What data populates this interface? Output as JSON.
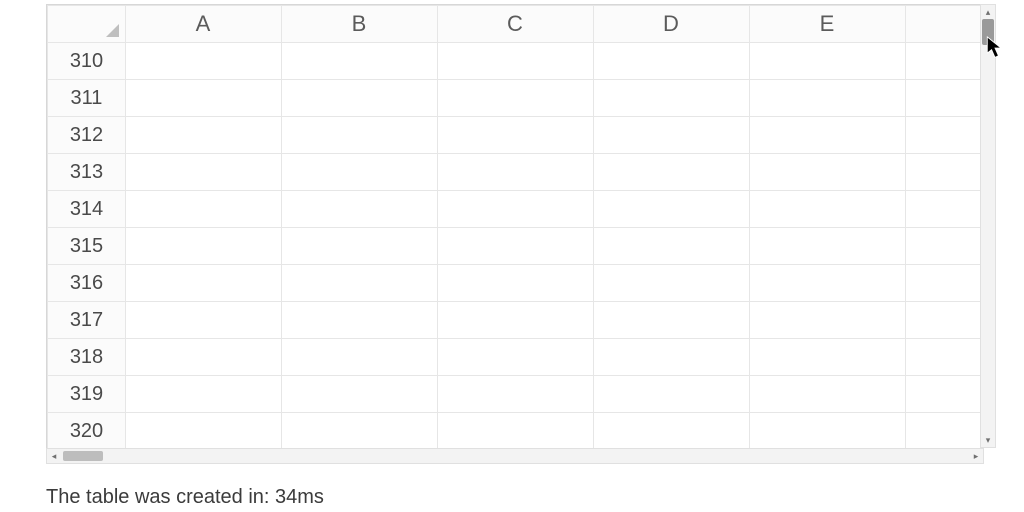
{
  "sheet": {
    "columns": [
      "A",
      "B",
      "C",
      "D",
      "E"
    ],
    "row_numbers": [
      310,
      311,
      312,
      313,
      314,
      315,
      316,
      317,
      318,
      319,
      320
    ]
  },
  "scroll": {
    "up_glyph": "▴",
    "down_glyph": "▾",
    "left_glyph": "◂",
    "right_glyph": "▸"
  },
  "status": {
    "text": "The table was created in: 34ms"
  }
}
